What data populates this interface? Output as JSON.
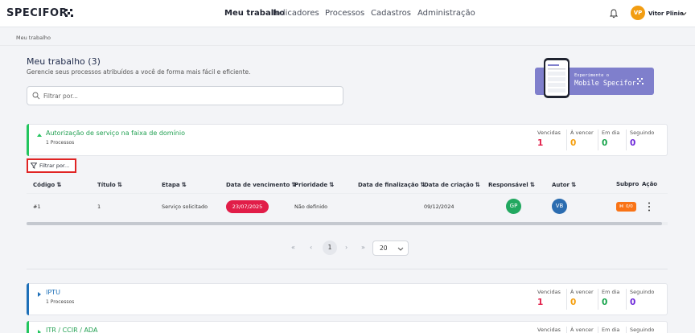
{
  "app": {
    "logo": "SPECIFOR"
  },
  "nav": [
    "Meu trabalho",
    "Indicadores",
    "Processos",
    "Cadastros",
    "Administração"
  ],
  "user": {
    "initials": "VP",
    "name": "Vitor Plinio"
  },
  "breadcrumb": "Meu trabalho",
  "page": {
    "title": "Meu trabalho (3)",
    "subtitle": "Gerencie seus processos atribuídos a você de forma mais fácil e eficiente.",
    "search_placeholder": "Filtrar por..."
  },
  "promo": {
    "line1": "Experimente o",
    "line2": "Mobile Specifor"
  },
  "stat_labels": [
    "Vencidas",
    "À vencer",
    "Em dia",
    "Seguindo"
  ],
  "colors": {
    "vencidas": "#e11d48",
    "a_vencer": "#f59e0b",
    "em_dia": "#16a34a",
    "seguindo": "#6d28d9"
  },
  "groups": [
    {
      "name": "Autorização de serviço na faixa de domínio",
      "sub": "1 Processos",
      "color": "#22c55e",
      "expanded": true,
      "stats": [
        "1",
        "0",
        "0",
        "0"
      ]
    },
    {
      "name": "IPTU",
      "sub": "1 Processos",
      "color": "#1d6fb8",
      "expanded": false,
      "stats": [
        "1",
        "0",
        "0",
        "0"
      ]
    },
    {
      "name": "ITR / CCIR / ADA",
      "sub": "",
      "color": "#22c55e",
      "expanded": false,
      "stats": []
    }
  ],
  "filter_button": "Filtrar por...",
  "table": {
    "headers": [
      "Código",
      "Título",
      "Etapa",
      "Data de vencimento",
      "Prioridade",
      "Data de finalização",
      "Data de criação",
      "Responsável",
      "Autor",
      "Subpro",
      "Ação"
    ],
    "row": {
      "codigo": "#1",
      "titulo": "1",
      "etapa": "Serviço solicitado",
      "vencimento": "23/07/2025",
      "prioridade": "Não definido",
      "finalizacao": "",
      "criacao": "09/12/2024",
      "responsavel": "GP",
      "autor": "VB",
      "subpro": "0/0"
    }
  },
  "pagination": {
    "first": "«",
    "prev": "‹",
    "current": "1",
    "next": "›",
    "last": "»",
    "page_size": "20"
  }
}
